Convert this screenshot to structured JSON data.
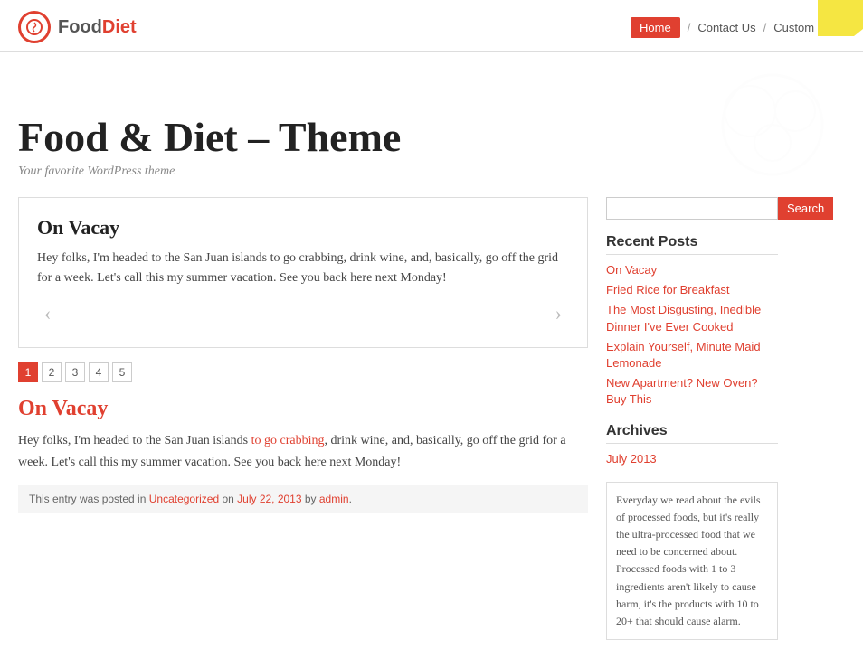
{
  "logo": {
    "food": "Food",
    "diet": "Diet",
    "icon": "♻"
  },
  "nav": {
    "home": "Home",
    "contact": "Contact Us",
    "custom_form": "Custom Form",
    "sep": "/"
  },
  "hero": {
    "title": "Food & Diet – Theme",
    "subtitle": "Your favorite WordPress theme"
  },
  "featured": {
    "title": "On Vacay",
    "body": "Hey folks, I'm headed to the San Juan islands to go crabbing, drink wine, and, basically, go off the grid for a week. Let's call this my summer vacation. See you back here next Monday!"
  },
  "pagination": {
    "pages": [
      "1",
      "2",
      "3",
      "4",
      "5"
    ],
    "active": 0
  },
  "post": {
    "title": "On Vacay",
    "body_before": "Hey folks, I'm headed to the San Juan islands ",
    "body_link": "to go crabbing",
    "body_after": ", drink wine, and, basically, go off the grid for a week. Let's call this my summer vacation. See you back here next Monday!",
    "meta_before": "This entry was posted in ",
    "meta_category": "Uncategorized",
    "meta_middle": " on ",
    "meta_date": "July 22, 2013",
    "meta_by": " by ",
    "meta_author": "admin",
    "meta_end": "."
  },
  "sidebar": {
    "search_placeholder": "",
    "search_btn": "Search",
    "recent_posts_title": "Recent Posts",
    "recent_posts": [
      "On Vacay",
      "Fried Rice for Breakfast",
      "The Most Disgusting, Inedible Dinner I've Ever Cooked",
      "Explain Yourself, Minute Maid Lemonade",
      "New Apartment? New Oven? Buy This"
    ],
    "archives_title": "Archives",
    "archives": [
      "July 2013"
    ],
    "sidebar_text": "Everyday we read about the evils of processed foods, but it's really the ultra-processed food that we need to be concerned about. Processed foods with 1 to 3 ingredients aren't likely to cause harm, it's the products with 10 to 20+ that should cause alarm."
  }
}
